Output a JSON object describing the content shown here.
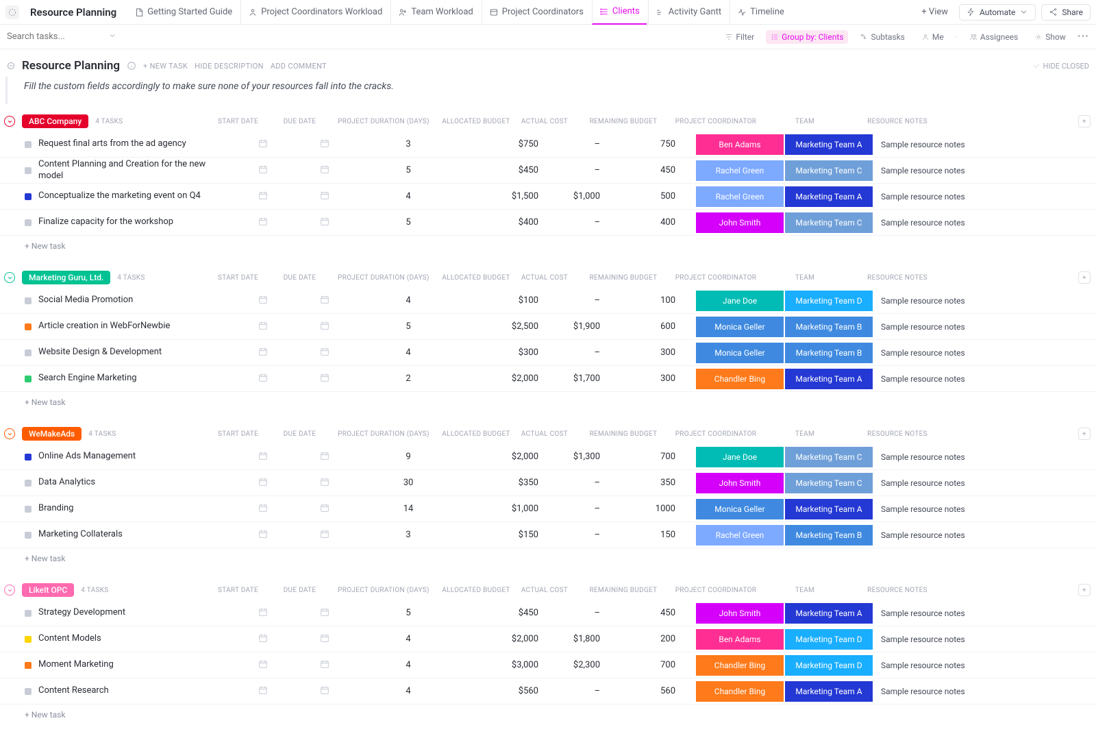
{
  "header": {
    "title": "Resource Planning",
    "tabs": [
      {
        "label": "Getting Started Guide"
      },
      {
        "label": "Project Coordinators Workload"
      },
      {
        "label": "Team Workload"
      },
      {
        "label": "Project Coordinators"
      },
      {
        "label": "Clients",
        "active": true
      },
      {
        "label": "Activity Gantt"
      },
      {
        "label": "Timeline"
      }
    ],
    "add_view": "+ View",
    "automate": "Automate",
    "share": "Share"
  },
  "filterbar": {
    "search_placeholder": "Search tasks...",
    "filter": "Filter",
    "group_by": "Group by: Clients",
    "subtasks": "Subtasks",
    "me": "Me",
    "assignees": "Assignees",
    "show": "Show"
  },
  "titlebar": {
    "title": "Resource Planning",
    "new_task": "+ NEW TASK",
    "hide_desc": "HIDE DESCRIPTION",
    "add_comment": "ADD COMMENT",
    "hide_closed": "HIDE CLOSED"
  },
  "description": "Fill the custom fields accordingly to make sure none of your resources fall into the cracks.",
  "columns": {
    "start_date": "START DATE",
    "due_date": "DUE DATE",
    "duration": "PROJECT DURATION (DAYS)",
    "budget": "ALLOCATED BUDGET",
    "cost": "ACTUAL COST",
    "remaining": "REMAINING BUDGET",
    "coordinator": "PROJECT COORDINATOR",
    "team": "TEAM",
    "notes": "RESOURCE NOTES"
  },
  "new_task_label": "+ New task",
  "colors": {
    "coord": {
      "Ben Adams": "#ff2e93",
      "Rachel Green": "#7da9ff",
      "John Smith": "#d500f9",
      "Jane Doe": "#00bcb4",
      "Monica Geller": "#3f8ae0",
      "Chandler Bing": "#ff7a1a"
    },
    "team": {
      "Marketing Team A": "#2438d4",
      "Marketing Team B": "#3f8ae0",
      "Marketing Team C": "#6f9fd8",
      "Marketing Team D": "#1aaeff"
    }
  },
  "groups": [
    {
      "name": "ABC Company",
      "color": "#e4002b",
      "count": "4 TASKS",
      "tasks": [
        {
          "status": "#c8ccd6",
          "name": "Request final arts from the ad agency",
          "dur": "3",
          "bud": "$750",
          "cost": "–",
          "rem": "750",
          "coord": "Ben Adams",
          "team": "Marketing Team A",
          "notes": "Sample resource notes"
        },
        {
          "status": "#c8ccd6",
          "name": "Content Planning and Creation for the new model",
          "dur": "5",
          "bud": "$450",
          "cost": "–",
          "rem": "450",
          "coord": "Rachel Green",
          "team": "Marketing Team C",
          "notes": "Sample resource notes"
        },
        {
          "status": "#2438d4",
          "name": "Conceptualize the marketing event on Q4",
          "dur": "4",
          "bud": "$1,500",
          "cost": "$1,000",
          "rem": "500",
          "coord": "Rachel Green",
          "team": "Marketing Team A",
          "notes": "Sample resource notes"
        },
        {
          "status": "#c8ccd6",
          "name": "Finalize capacity for the workshop",
          "dur": "5",
          "bud": "$400",
          "cost": "–",
          "rem": "400",
          "coord": "John Smith",
          "team": "Marketing Team C",
          "notes": "Sample resource notes"
        }
      ]
    },
    {
      "name": "Marketing Guru, Ltd.",
      "color": "#00c292",
      "count": "4 TASKS",
      "tasks": [
        {
          "status": "#c8ccd6",
          "name": "Social Media Promotion",
          "dur": "4",
          "bud": "$100",
          "cost": "–",
          "rem": "100",
          "coord": "Jane Doe",
          "team": "Marketing Team D",
          "notes": "Sample resource notes"
        },
        {
          "status": "#ff7a1a",
          "name": "Article creation in WebForNewbie",
          "dur": "5",
          "bud": "$2,500",
          "cost": "$1,900",
          "rem": "600",
          "coord": "Monica Geller",
          "team": "Marketing Team B",
          "notes": "Sample resource notes"
        },
        {
          "status": "#c8ccd6",
          "name": "Website Design & Development",
          "dur": "4",
          "bud": "$300",
          "cost": "–",
          "rem": "300",
          "coord": "Monica Geller",
          "team": "Marketing Team B",
          "notes": "Sample resource notes"
        },
        {
          "status": "#2ecc71",
          "name": "Search Engine Marketing",
          "dur": "2",
          "bud": "$2,000",
          "cost": "$1,700",
          "rem": "300",
          "coord": "Chandler Bing",
          "team": "Marketing Team A",
          "notes": "Sample resource notes"
        }
      ]
    },
    {
      "name": "WeMakeAds",
      "color": "#ff5c00",
      "count": "4 TASKS",
      "tasks": [
        {
          "status": "#2438d4",
          "name": "Online Ads Management",
          "dur": "9",
          "bud": "$2,000",
          "cost": "$1,300",
          "rem": "700",
          "coord": "Jane Doe",
          "team": "Marketing Team C",
          "notes": "Sample resource notes"
        },
        {
          "status": "#c8ccd6",
          "name": "Data Analytics",
          "dur": "30",
          "bud": "$350",
          "cost": "–",
          "rem": "350",
          "coord": "John Smith",
          "team": "Marketing Team C",
          "notes": "Sample resource notes"
        },
        {
          "status": "#c8ccd6",
          "name": "Branding",
          "dur": "14",
          "bud": "$1,000",
          "cost": "–",
          "rem": "1000",
          "coord": "Monica Geller",
          "team": "Marketing Team A",
          "notes": "Sample resource notes"
        },
        {
          "status": "#c8ccd6",
          "name": "Marketing Collaterals",
          "dur": "3",
          "bud": "$150",
          "cost": "–",
          "rem": "150",
          "coord": "Rachel Green",
          "team": "Marketing Team B",
          "notes": "Sample resource notes"
        }
      ]
    },
    {
      "name": "LikeIt OPC",
      "color": "#ff6ab0",
      "count": "4 TASKS",
      "tasks": [
        {
          "status": "#c8ccd6",
          "name": "Strategy Development",
          "dur": "5",
          "bud": "$450",
          "cost": "–",
          "rem": "450",
          "coord": "John Smith",
          "team": "Marketing Team A",
          "notes": "Sample resource notes"
        },
        {
          "status": "#ffd500",
          "name": "Content Models",
          "dur": "4",
          "bud": "$2,000",
          "cost": "$1,800",
          "rem": "200",
          "coord": "Ben Adams",
          "team": "Marketing Team D",
          "notes": "Sample resource notes"
        },
        {
          "status": "#ff7a1a",
          "name": "Moment Marketing",
          "dur": "4",
          "bud": "$3,000",
          "cost": "$2,300",
          "rem": "700",
          "coord": "Chandler Bing",
          "team": "Marketing Team D",
          "notes": "Sample resource notes"
        },
        {
          "status": "#c8ccd6",
          "name": "Content Research",
          "dur": "4",
          "bud": "$560",
          "cost": "–",
          "rem": "560",
          "coord": "Chandler Bing",
          "team": "Marketing Team A",
          "notes": "Sample resource notes"
        }
      ]
    }
  ]
}
